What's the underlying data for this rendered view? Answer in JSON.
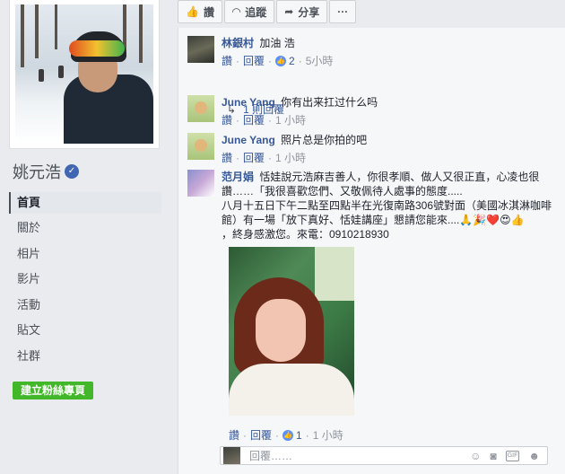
{
  "profile": {
    "name": "姚元浩",
    "verified_icon": "verified-check-icon"
  },
  "nav": {
    "items": [
      "首頁",
      "關於",
      "相片",
      "影片",
      "活動",
      "貼文",
      "社群"
    ],
    "active_index": 0
  },
  "create_page_button": "建立粉絲專頁",
  "action_bar": {
    "like": "讚",
    "follow": "追蹤",
    "share": "分享",
    "more": "···"
  },
  "comments": [
    {
      "author": "林銀村",
      "text": "加油 浩",
      "actions": {
        "like": "讚",
        "reply": "回覆"
      },
      "like_count": "2",
      "time": "5小時",
      "replies_link": "1 則回覆"
    },
    {
      "author": "June Yang",
      "text": "你有出来扛过什么吗",
      "actions": {
        "like": "讚",
        "reply": "回覆"
      },
      "time": "1 小時"
    },
    {
      "author": "June Yang",
      "text": "照片总是你拍的吧",
      "actions": {
        "like": "讚",
        "reply": "回覆"
      },
      "time": "1 小時"
    },
    {
      "author": "范月娟",
      "text_line1": "恬娃說元浩麻吉善人，你很孝順、做人又很正直，心凌也很讚……「我很喜歡您們、又敬佩待人處事的態度.....",
      "text_line2": "八月十五日下午二點至四點半在光復南路306號對面（美國冰淇淋咖啡館）有一場「放下真好、恬娃講座」懇請您能來....🙏🎉❤️😍👍",
      "text_line3": "，終身感激您。來電：0910218930",
      "actions": {
        "like": "讚",
        "reply": "回覆"
      },
      "like_count": "1",
      "time": "1 小時"
    }
  ],
  "reply_box": {
    "placeholder": "回覆……",
    "tools": [
      "emoji-icon",
      "camera-icon",
      "gif-icon",
      "sticker-icon"
    ],
    "gif_label": "GIF"
  }
}
